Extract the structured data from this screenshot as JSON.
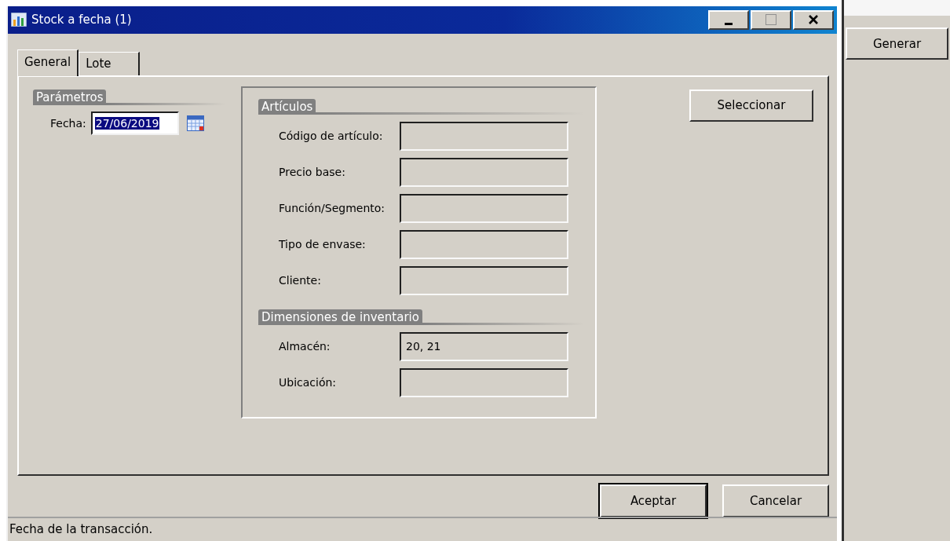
{
  "window": {
    "title": "Stock a fecha (1)"
  },
  "tabs": [
    {
      "label": "General",
      "selected": true
    },
    {
      "label": "Lote",
      "selected": false
    }
  ],
  "parametros": {
    "heading": "Parámetros",
    "date_label": "Fecha:",
    "date_value": "27/06/2019",
    "value_selected": true
  },
  "articulos": {
    "heading": "Artículos",
    "fields": [
      {
        "label": "Código de artículo:"
      },
      {
        "label": "Precio base:"
      },
      {
        "label": "Función/Segmento:"
      },
      {
        "label": "Tipo de envase:"
      },
      {
        "label": "Cliente:"
      }
    ]
  },
  "dimensiones": {
    "heading": "Dimensiones de inventario",
    "fields": [
      {
        "label": "Almacén:",
        "value": "20, 21"
      },
      {
        "label": "Ubicación:"
      }
    ]
  },
  "select_button": "Seleccionar",
  "buttons": [
    {
      "label": "Aceptar",
      "default": true
    },
    {
      "label": "Cancelar",
      "default": false
    }
  ],
  "status_bar": "Fecha de la transacción.",
  "side_panel": {
    "button": "Generar"
  }
}
